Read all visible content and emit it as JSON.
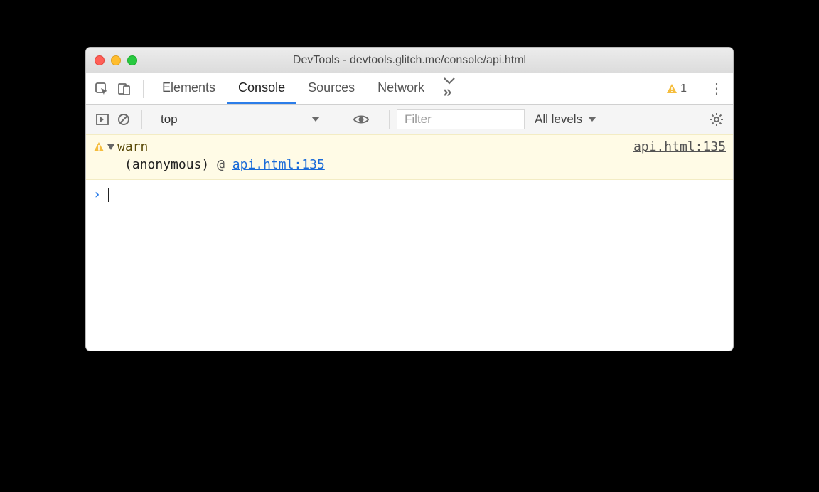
{
  "window": {
    "title": "DevTools - devtools.glitch.me/console/api.html"
  },
  "tabs": {
    "elements": "Elements",
    "console": "Console",
    "sources": "Sources",
    "network": "Network"
  },
  "warning_count": "1",
  "toolbar": {
    "context": "top",
    "filter_placeholder": "Filter",
    "levels": "All levels"
  },
  "console": {
    "warn_label": "warn",
    "source_link": "api.html:135",
    "stack_func": "(anonymous)",
    "stack_at": "@",
    "stack_link": "api.html:135",
    "prompt": "›"
  }
}
